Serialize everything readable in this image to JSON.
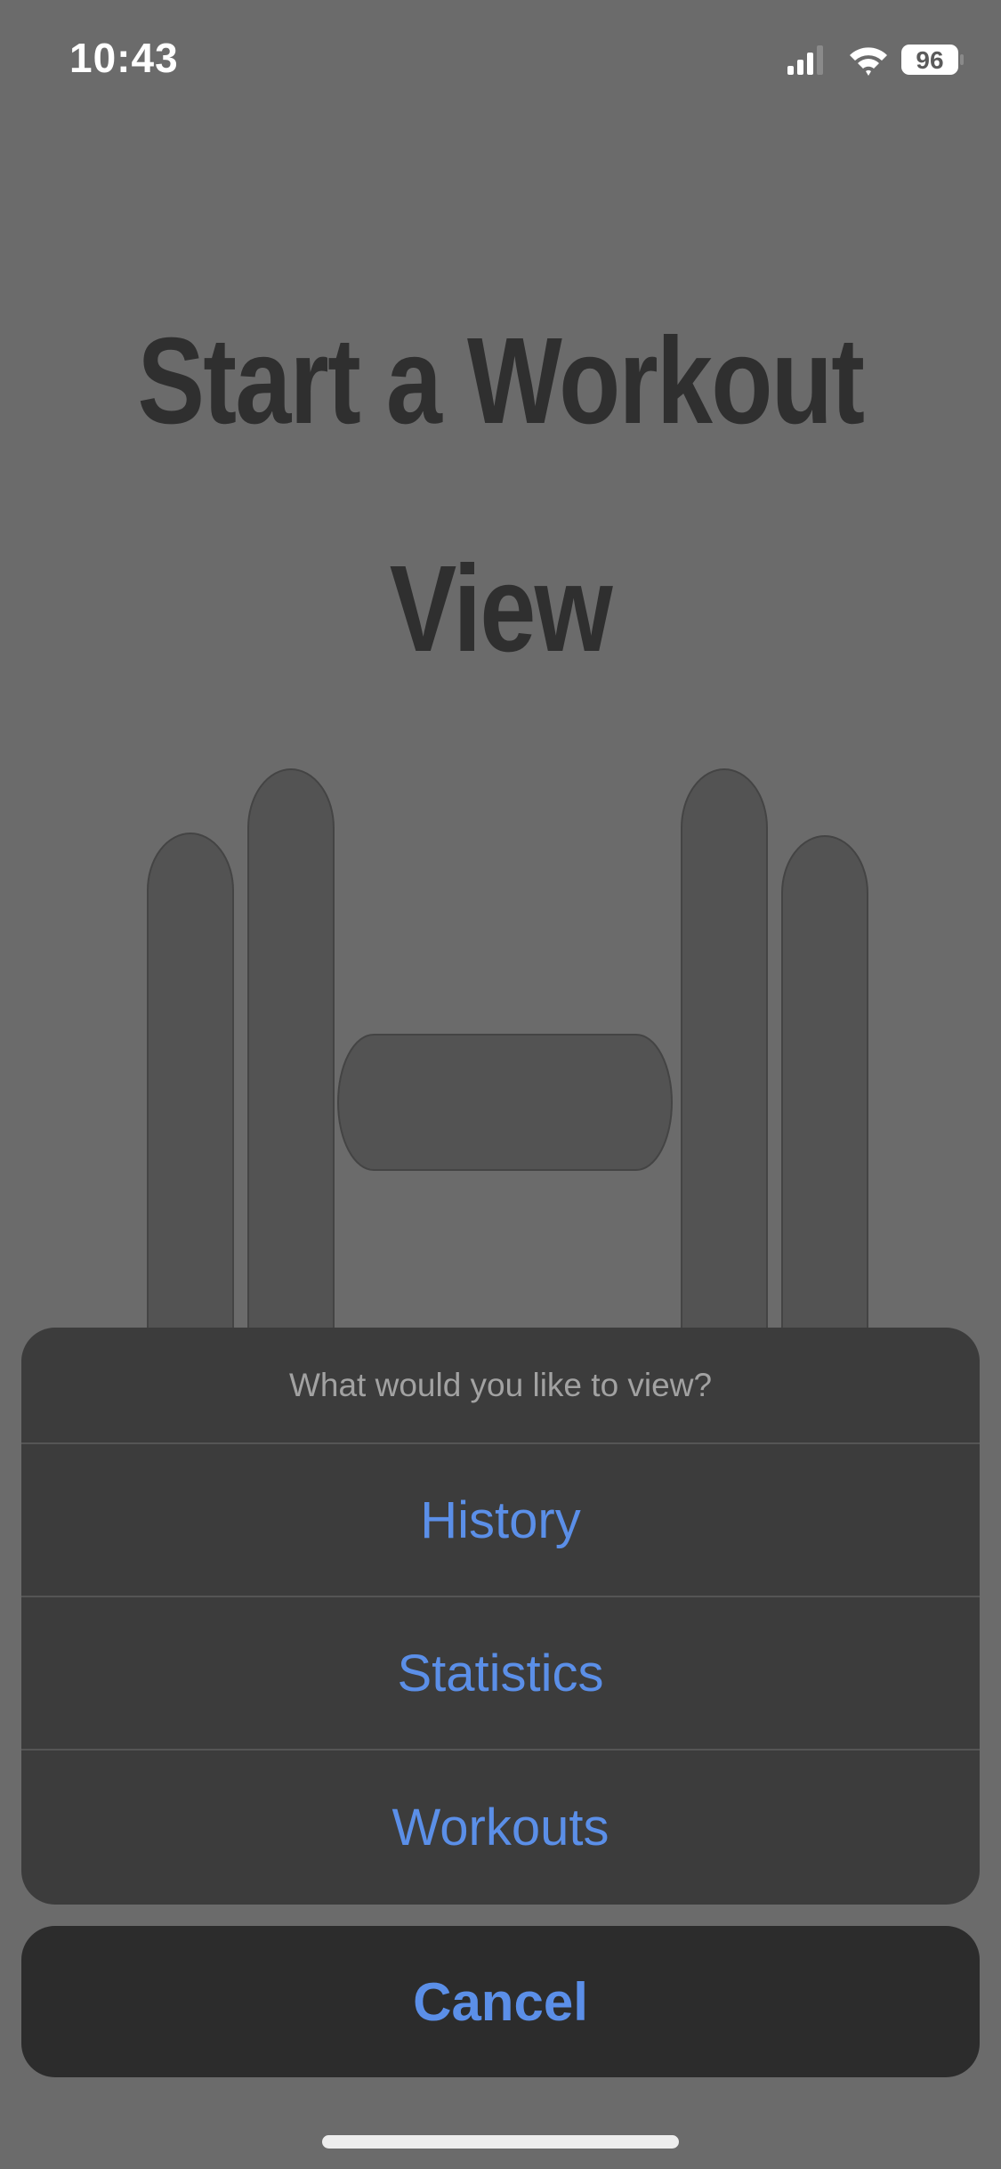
{
  "status_bar": {
    "time": "10:43",
    "battery_level": "96",
    "icons": [
      "cellular-signal-icon",
      "wifi-icon",
      "battery-icon"
    ]
  },
  "page": {
    "title_line1": "Start a Workout",
    "title_line2": "View",
    "illustration": "dumbbell-icon"
  },
  "action_sheet": {
    "header": "What would you like to view?",
    "options": [
      {
        "label": "History"
      },
      {
        "label": "Statistics"
      },
      {
        "label": "Workouts"
      }
    ],
    "cancel_label": "Cancel"
  },
  "colors": {
    "background": "#6b6b6b",
    "sheet_background": "#3c3c3c",
    "cancel_background": "#2c2c2c",
    "accent": "#5b8fe8",
    "title": "#2f2f2f",
    "illustration": "#535353"
  }
}
